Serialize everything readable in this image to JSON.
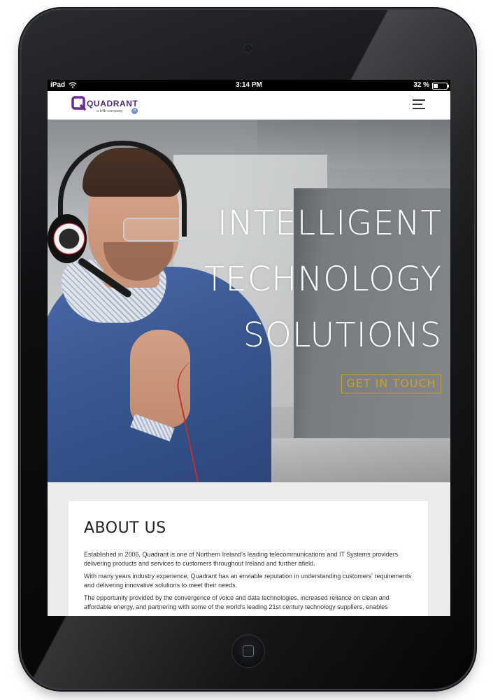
{
  "status_bar": {
    "carrier": "iPad",
    "time": "3:14 PM",
    "battery": "32 %",
    "battery_level": 0.32
  },
  "navbar": {
    "logo_text": "QUADRANT",
    "logo_tagline": "a b4b company",
    "logo_badge": "b",
    "menu_icon": "hamburger-menu-icon"
  },
  "hero": {
    "headline": [
      "INTELLIGENT",
      "TECHNOLOGY",
      "SOLUTIONS"
    ],
    "cta_label": "GET IN TOUCH"
  },
  "about": {
    "title": "ABOUT US",
    "paragraphs": [
      "Established in 2006, Quadrant is one of Northern Ireland's leading telecommunications and IT Systems providers delivering products and services to customers throughout Ireland and further afield.",
      "With many years industry experience, Quadrant has an enviable reputation in understanding customers' requirements and delivering innovative solutions to meet their needs.",
      "The opportunity provided by the convergence of voice and data technologies, increased reliance on clean and affordable energy, and partnering with some of the world's leading 21st century technology suppliers, enables"
    ]
  },
  "colors": {
    "brand_purple": "#4d2a7e",
    "cta_gold": "#c9a227",
    "device_frame": "#0d0e10"
  }
}
